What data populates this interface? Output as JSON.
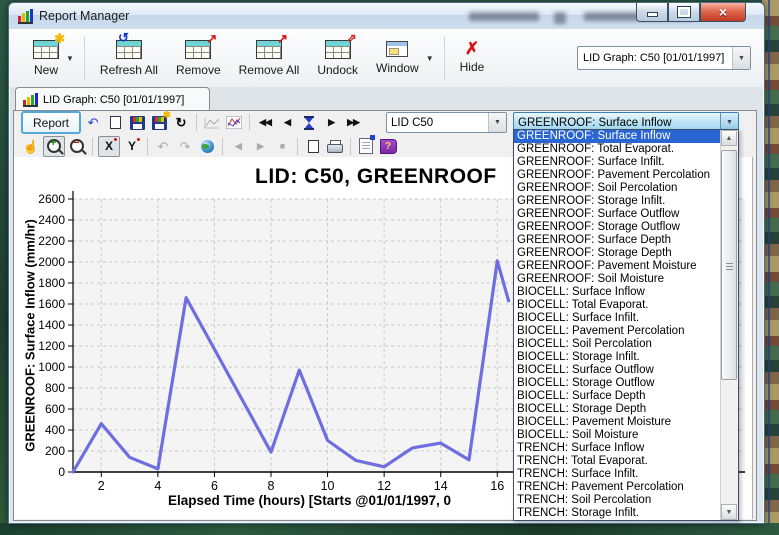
{
  "window": {
    "title": "Report Manager"
  },
  "colors": {
    "selection_highlight": "#2a65d4",
    "chart_line": "#6e6ee0",
    "focused_combo": "#9ed6f0",
    "close_button": "#c23a22"
  },
  "main_toolbar": {
    "buttons": [
      {
        "label": "New",
        "icon": "new-report-icon",
        "has_dropdown": true
      },
      {
        "label": "Refresh All",
        "icon": "refresh-all-icon"
      },
      {
        "label": "Remove",
        "icon": "remove-report-icon"
      },
      {
        "label": "Remove All",
        "icon": "remove-all-icon"
      },
      {
        "label": "Undock",
        "icon": "undock-icon"
      },
      {
        "label": "Window",
        "icon": "window-icon",
        "has_dropdown": true
      },
      {
        "label": "Hide",
        "icon": "hide-icon"
      }
    ],
    "report_selector_value": "LID Graph: C50 [01/01/1997]"
  },
  "tab": {
    "label": "LID Graph: C50 [01/01/1997]",
    "icon": "bar-chart-icon"
  },
  "graph_toolbar": {
    "report_button_label": "Report",
    "lid_selector_value": "LID C50",
    "param_selector_value": "GREENROOF: Surface Inflow",
    "x_axis_button_label": "X",
    "y_axis_button_label": "Y"
  },
  "icons": {
    "rewind": "◀◀",
    "previous": "◀",
    "next": "▶",
    "fast_forward": "▶▶",
    "refresh": "↻",
    "restore_chart": "↶",
    "undo_zoom": "↶",
    "redo_zoom": "↷",
    "back": "◀",
    "forward": "▶",
    "stop": "■",
    "hand": "☝",
    "new_star": "✱",
    "refresh_arrows": "↺",
    "remove_arrow": "↗",
    "undock_arrow": "⇗",
    "hide_x": "✗",
    "zoom_in_sign": "+",
    "zoom_out_sign": "−",
    "dropdown_arrow": "▼",
    "scroll_up": "▲",
    "scroll_down": "▼",
    "help_question": "?"
  },
  "param_dropdown": {
    "selected_index": 0,
    "items": [
      "GREENROOF: Surface Inflow",
      "GREENROOF: Total Evaporat.",
      "GREENROOF: Surface Infilt.",
      "GREENROOF: Pavement Percolation",
      "GREENROOF: Soil Percolation",
      "GREENROOF: Storage Infilt.",
      "GREENROOF: Surface Outflow",
      "GREENROOF: Storage Outflow",
      "GREENROOF: Surface Depth",
      "GREENROOF: Storage Depth",
      "GREENROOF: Pavement Moisture",
      "GREENROOF: Soil Moisture",
      "BIOCELL: Surface Inflow",
      "BIOCELL: Total Evaporat.",
      "BIOCELL: Surface Infilt.",
      "BIOCELL: Pavement Percolation",
      "BIOCELL: Soil Percolation",
      "BIOCELL: Storage Infilt.",
      "BIOCELL: Surface Outflow",
      "BIOCELL: Storage Outflow",
      "BIOCELL: Surface Depth",
      "BIOCELL: Storage Depth",
      "BIOCELL: Pavement Moisture",
      "BIOCELL: Soil Moisture",
      "TRENCH: Surface Inflow",
      "TRENCH: Total Evaporat.",
      "TRENCH: Surface Infilt.",
      "TRENCH: Pavement Percolation",
      "TRENCH: Soil Percolation",
      "TRENCH: Storage Infilt."
    ]
  },
  "chart_data": {
    "type": "line",
    "title": "LID: C50, GREENROOF",
    "ylabel": "GREENROOF: Surface Inflow (mm/hr)",
    "xlabel": "Elapsed Time (hours) [Starts @01/01/1997, 0",
    "x": [
      1,
      2,
      3,
      4,
      5,
      6,
      7,
      8,
      9,
      10,
      11,
      12,
      13,
      14,
      15,
      16,
      16.4
    ],
    "values": [
      0,
      460,
      140,
      30,
      1660,
      1170,
      680,
      190,
      970,
      300,
      110,
      50,
      230,
      275,
      115,
      2010,
      1630
    ],
    "ylim": [
      0,
      2600
    ],
    "y_tick_step": 200,
    "x_ticks": [
      2,
      4,
      6,
      8,
      10,
      12,
      14,
      16
    ],
    "line_color": "#6e6ee0",
    "grid": true,
    "legend": false
  }
}
